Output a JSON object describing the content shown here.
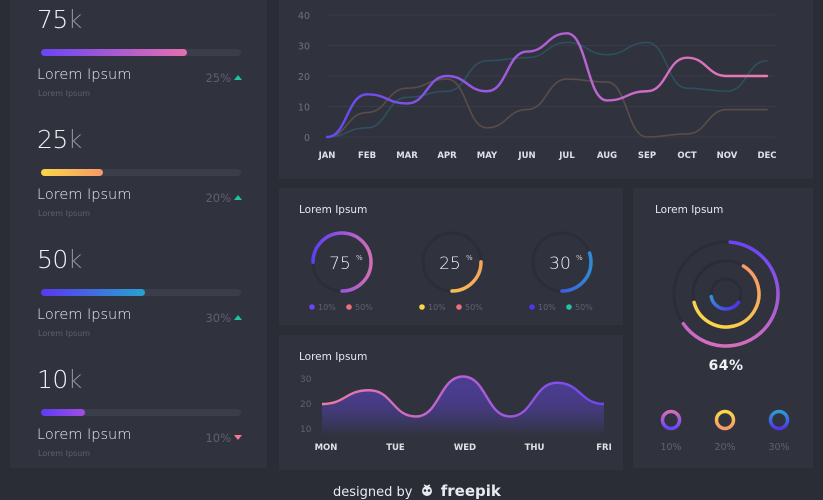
{
  "stats": [
    {
      "value": "75",
      "unit": "k",
      "progress": 0.73,
      "gradient": [
        "#6a45f5",
        "#e56fb0"
      ],
      "label": "Lorem Ipsum",
      "sublabel": "Lorem Ipsum",
      "change": "25%",
      "trend": "up"
    },
    {
      "value": "25",
      "unit": "k",
      "progress": 0.31,
      "gradient": [
        "#fbd649",
        "#f79a68"
      ],
      "label": "Lorem Ipsum",
      "sublabel": "Lorem Ipsum",
      "change": "20%",
      "trend": "up"
    },
    {
      "value": "50",
      "unit": "k",
      "progress": 0.52,
      "gradient": [
        "#5b37f0",
        "#27a2d2"
      ],
      "label": "Lorem Ipsum",
      "sublabel": "Lorem Ipsum",
      "change": "30%",
      "trend": "up"
    },
    {
      "value": "10",
      "unit": "k",
      "progress": 0.22,
      "gradient": [
        "#5c3df5",
        "#a24de0"
      ],
      "label": "Lorem Ipsum",
      "sublabel": "Lorem Ipsum",
      "change": "10%",
      "trend": "down"
    }
  ],
  "colors": {
    "trend_up": "#1fc4a4",
    "trend_down": "#f5778f",
    "panel": "#30333e",
    "background": "#2a2d36"
  },
  "chart_data": [
    {
      "type": "line",
      "title": "",
      "categories": [
        "JAN",
        "FEB",
        "MAR",
        "APR",
        "MAY",
        "JUN",
        "JUL",
        "AUG",
        "SEP",
        "OCT",
        "NOV",
        "DEC"
      ],
      "ylim": [
        0,
        40
      ],
      "yticks": [
        0,
        10,
        20,
        30,
        40
      ],
      "grid": true,
      "series": [
        {
          "name": "primary",
          "values": [
            0,
            14,
            11,
            20,
            15,
            28,
            34,
            12,
            15,
            26,
            20,
            20
          ],
          "gradient": [
            "#6449f2",
            "#b05fd8",
            "#f07ab0"
          ]
        },
        {
          "name": "secondary-brown",
          "values": [
            0,
            8,
            16,
            19,
            3,
            9,
            19,
            18,
            0,
            1,
            9,
            9
          ],
          "color": "#5a4d48"
        },
        {
          "name": "secondary-teal",
          "values": [
            0,
            3,
            13,
            15,
            25,
            26,
            31,
            27,
            31,
            16,
            15,
            25
          ],
          "color": "#2e4f5e"
        }
      ]
    },
    {
      "type": "pie",
      "title": "Lorem Ipsum",
      "gauges": [
        {
          "value": 75,
          "unit": "%",
          "gradient": [
            "#5c40ef",
            "#9a55e0",
            "#d06fb5"
          ],
          "legend": [
            {
              "color": "#6a45f5",
              "label": "10%"
            },
            {
              "color": "#f26c7e",
              "label": "50%"
            }
          ]
        },
        {
          "value": 25,
          "unit": "%",
          "gradient": [
            "#fcd84a",
            "#f6a55a"
          ],
          "legend": [
            {
              "color": "#fbd649",
              "label": "10%"
            },
            {
              "color": "#f26c7e",
              "label": "50%"
            }
          ]
        },
        {
          "value": 30,
          "unit": "%",
          "gradient": [
            "#5030e8",
            "#2f8ad5"
          ],
          "legend": [
            {
              "color": "#5533ea",
              "label": "10%"
            },
            {
              "color": "#1fc4a4",
              "label": "50%"
            }
          ]
        }
      ]
    },
    {
      "type": "area",
      "title": "Lorem Ipsum",
      "categories": [
        "MON",
        "TUE",
        "WED",
        "THU",
        "FRI"
      ],
      "ylim": [
        10,
        30
      ],
      "yticks": [
        10,
        20,
        30
      ],
      "x": [
        0,
        0.5,
        1,
        1.5,
        2,
        2.5,
        3,
        3.5,
        4
      ],
      "values": [
        20,
        25.5,
        15,
        31,
        15,
        28.5,
        20
      ],
      "gradient": [
        "#f07aa6",
        "#b65fd6",
        "#6a48f0"
      ]
    },
    {
      "type": "pie",
      "title": "Lorem Ipsum",
      "center_label": "64%",
      "rings": [
        {
          "value": 0.64,
          "gradient": [
            "#d46fbb",
            "#6a45f5"
          ],
          "legend": "10%"
        },
        {
          "value": 0.62,
          "gradient": [
            "#fbd649",
            "#f79a68"
          ],
          "legend": "20%"
        },
        {
          "value": 0.38,
          "gradient": [
            "#2e9bd3",
            "#5034e8"
          ],
          "legend": "30%"
        }
      ]
    }
  ],
  "panels": {
    "donuts_title": "Lorem Ipsum",
    "week_title": "Lorem Ipsum",
    "rings_title": "Lorem Ipsum",
    "rings_center": "64%"
  },
  "footer": {
    "prefix": "designed by",
    "brand": "freepik",
    "logo_icon": "freepik-logo-icon"
  }
}
